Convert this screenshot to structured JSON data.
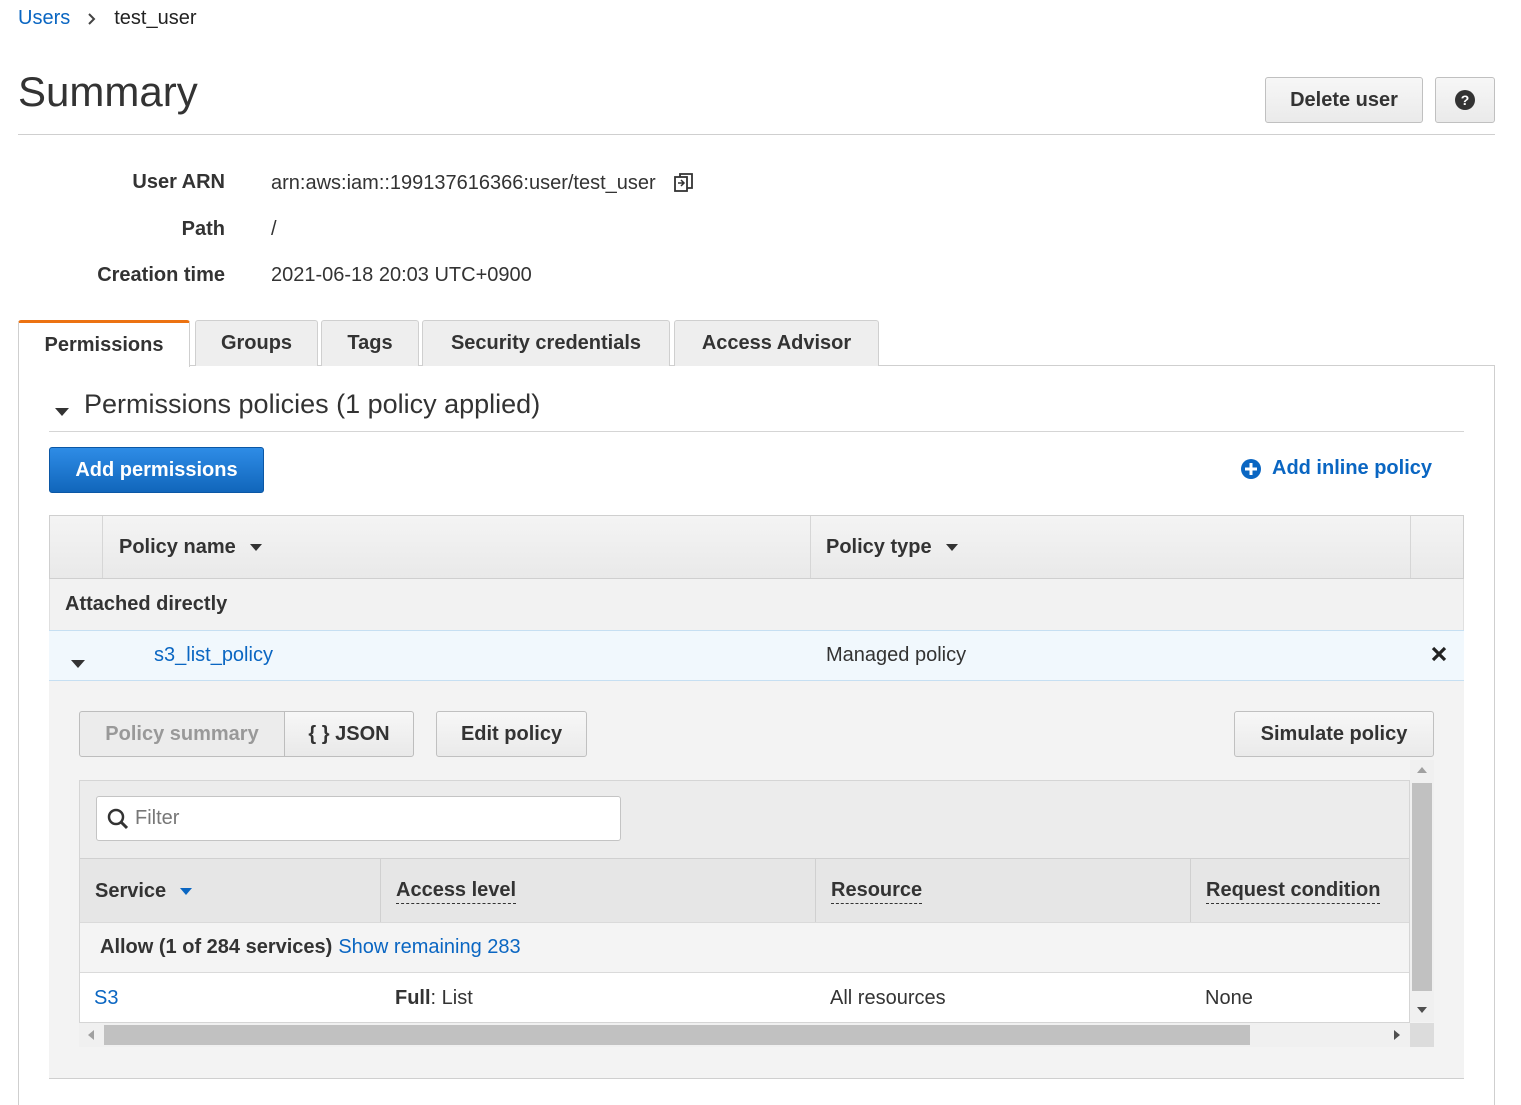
{
  "breadcrumb": {
    "parent": "Users",
    "current": "test_user"
  },
  "page": {
    "title": "Summary"
  },
  "header": {
    "delete_label": "Delete user",
    "help_label": "?"
  },
  "summary": {
    "arn_label": "User ARN",
    "arn_value": "arn:aws:iam::199137616366:user/test_user",
    "path_label": "Path",
    "path_value": "/",
    "creation_label": "Creation time",
    "creation_value": "2021-06-18 20:03 UTC+0900"
  },
  "tabs": [
    {
      "label": "Permissions",
      "active": true
    },
    {
      "label": "Groups",
      "active": false
    },
    {
      "label": "Tags",
      "active": false
    },
    {
      "label": "Security credentials",
      "active": false
    },
    {
      "label": "Access Advisor",
      "active": false
    }
  ],
  "permissions": {
    "section_title": "Permissions policies (1 policy applied)",
    "add_permissions_label": "Add permissions",
    "add_inline_label": "Add inline policy",
    "columns": {
      "policy_name": "Policy name",
      "policy_type": "Policy type"
    },
    "group_label": "Attached directly",
    "policy": {
      "name": "s3_list_policy",
      "type": "Managed policy"
    }
  },
  "policy_detail": {
    "summary_tab": "Policy summary",
    "json_tab": "{ } JSON",
    "edit_label": "Edit policy",
    "simulate_label": "Simulate policy",
    "filter_placeholder": "Filter",
    "columns": {
      "service": "Service",
      "access_level": "Access level",
      "resource": "Resource",
      "request_condition": "Request condition"
    },
    "allow_text": "Allow (1 of 284 services)",
    "show_remaining": "Show remaining 283",
    "row": {
      "service": "S3",
      "access_bold": "Full",
      "access_rest": ": List",
      "resource": "All resources",
      "condition": "None"
    }
  },
  "colors": {
    "accent": "#ec7211",
    "link": "#0a66c2",
    "primary": "#1a73c9"
  }
}
